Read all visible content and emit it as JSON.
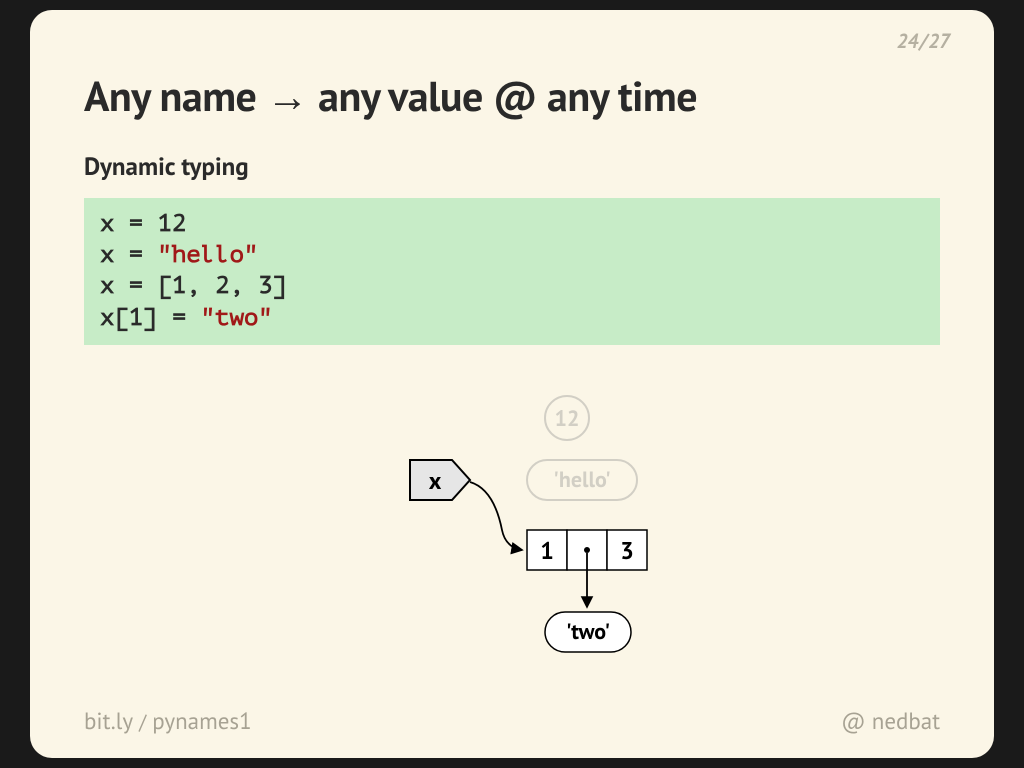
{
  "pager": {
    "current": "24",
    "total": "27"
  },
  "title": "Any name → any value @ any time",
  "subtitle": "Dynamic typing",
  "code": {
    "l1a": "x = ",
    "l1b": "12",
    "l2a": "x = ",
    "l2b": "\"hello\"",
    "l3a": "x = [",
    "l3b": "1",
    "l3c": ", ",
    "l3d": "2",
    "l3e": ", ",
    "l3f": "3",
    "l3g": "]",
    "l4a": "x[",
    "l4b": "1",
    "l4c": "] = ",
    "l4d": "\"two\""
  },
  "diagram": {
    "name_label": "x",
    "ghost_int": "12",
    "ghost_str": "'hello'",
    "list": {
      "cell0": "1",
      "cell2": "3"
    },
    "two_label": "'two'"
  },
  "footer": {
    "link_a": "bit.ly",
    "link_sep": "/",
    "link_b": "pynames1",
    "handle_at": "@",
    "handle_name": "nedbat"
  }
}
